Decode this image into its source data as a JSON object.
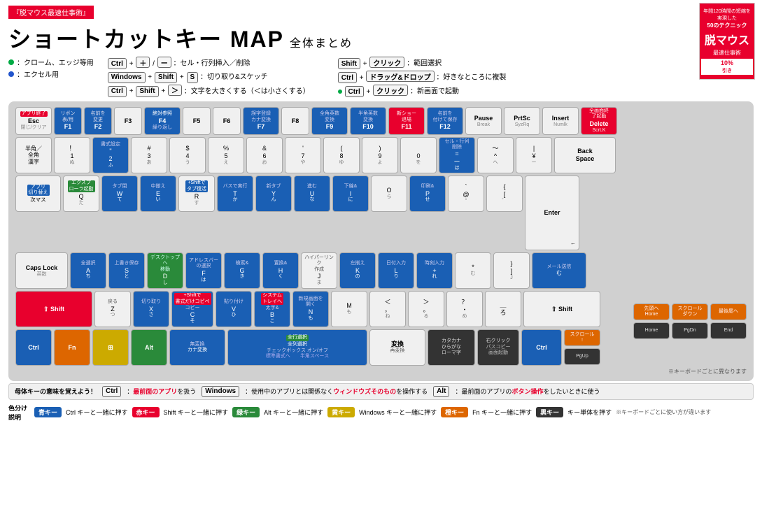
{
  "title_badge": "『脱マウス最速仕事術』",
  "main_title": "ショートカットキー MAP",
  "main_title_sub": "全体まとめ",
  "legend": {
    "chrome_label": "：クローム、エッジ等用",
    "excel_label": "：エクセル用",
    "shortcut1": "Ctrl + ＋ / ー：セル・行列挿入／削除",
    "shortcut2": "Windows + Shift + S：切り取り&スケッチ",
    "shortcut3": "Ctrl + Shift + ＞：文字を大きくする（＜は小さくする）",
    "shortcut4": "Shift + クリック：範囲選択",
    "shortcut5": "Ctrl + ドラッグ&ドロップ：好きなところに複製",
    "shortcut6": "Ctrl + クリック：新画面で起動"
  },
  "bottom_note": {
    "ctrl_label": "Ctrl",
    "ctrl_desc": "：最前面のアプリを扱う",
    "windows_label": "Windows",
    "windows_desc": "：使用中のアプリとは関係なくウィンドウズそのものを操作する",
    "alt_label": "Alt",
    "alt_desc": "：最前面のアプリのボタン操作をしたいときに使う"
  },
  "color_legend": {
    "blue_label": "青キー",
    "blue_desc": "Ctrl キーと一緒に押す",
    "red_label": "赤キー",
    "red_desc": "Shift キーと一緒に押す",
    "green_label": "緑キー",
    "green_desc": "Alt キーと一緒に押す",
    "yellow_label": "黄キー",
    "yellow_desc": "Windows キーと一緒に押す",
    "orange_label": "橙キー",
    "orange_desc": "Fn キーと一緒に押す",
    "dark_label": "黒キー",
    "dark_desc": "キー単体を押す",
    "note": "※キーボードごとに使い方が違います"
  },
  "keyboard_note": "※キーボードごとに異なります",
  "backspace_label": "Back\nSpace"
}
